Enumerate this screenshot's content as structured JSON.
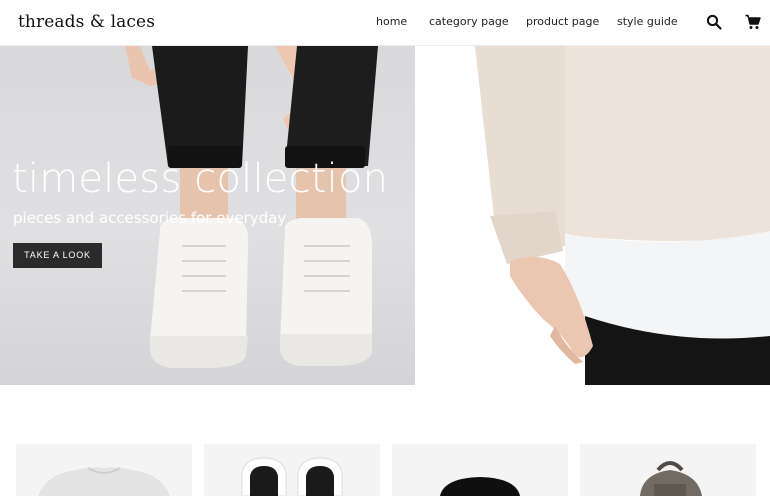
{
  "header": {
    "logo": "threads & laces",
    "nav": [
      {
        "label": "home"
      },
      {
        "label": "category page"
      },
      {
        "label": "product page"
      },
      {
        "label": "style guide"
      }
    ],
    "icons": {
      "search": "search-icon",
      "cart": "cart-icon"
    }
  },
  "hero": {
    "title": "timeless collection",
    "subtitle": "pieces and accessories for everyday",
    "cta": "TAKE A LOOK"
  },
  "products": [
    {
      "image": "sweatshirt"
    },
    {
      "image": "sneakers"
    },
    {
      "image": "beanie"
    },
    {
      "image": "backpack"
    }
  ],
  "colors": {
    "cta_bg": "#2b2b2b",
    "hero_text": "#ffffff",
    "card_bg": "#f4f4f4"
  }
}
